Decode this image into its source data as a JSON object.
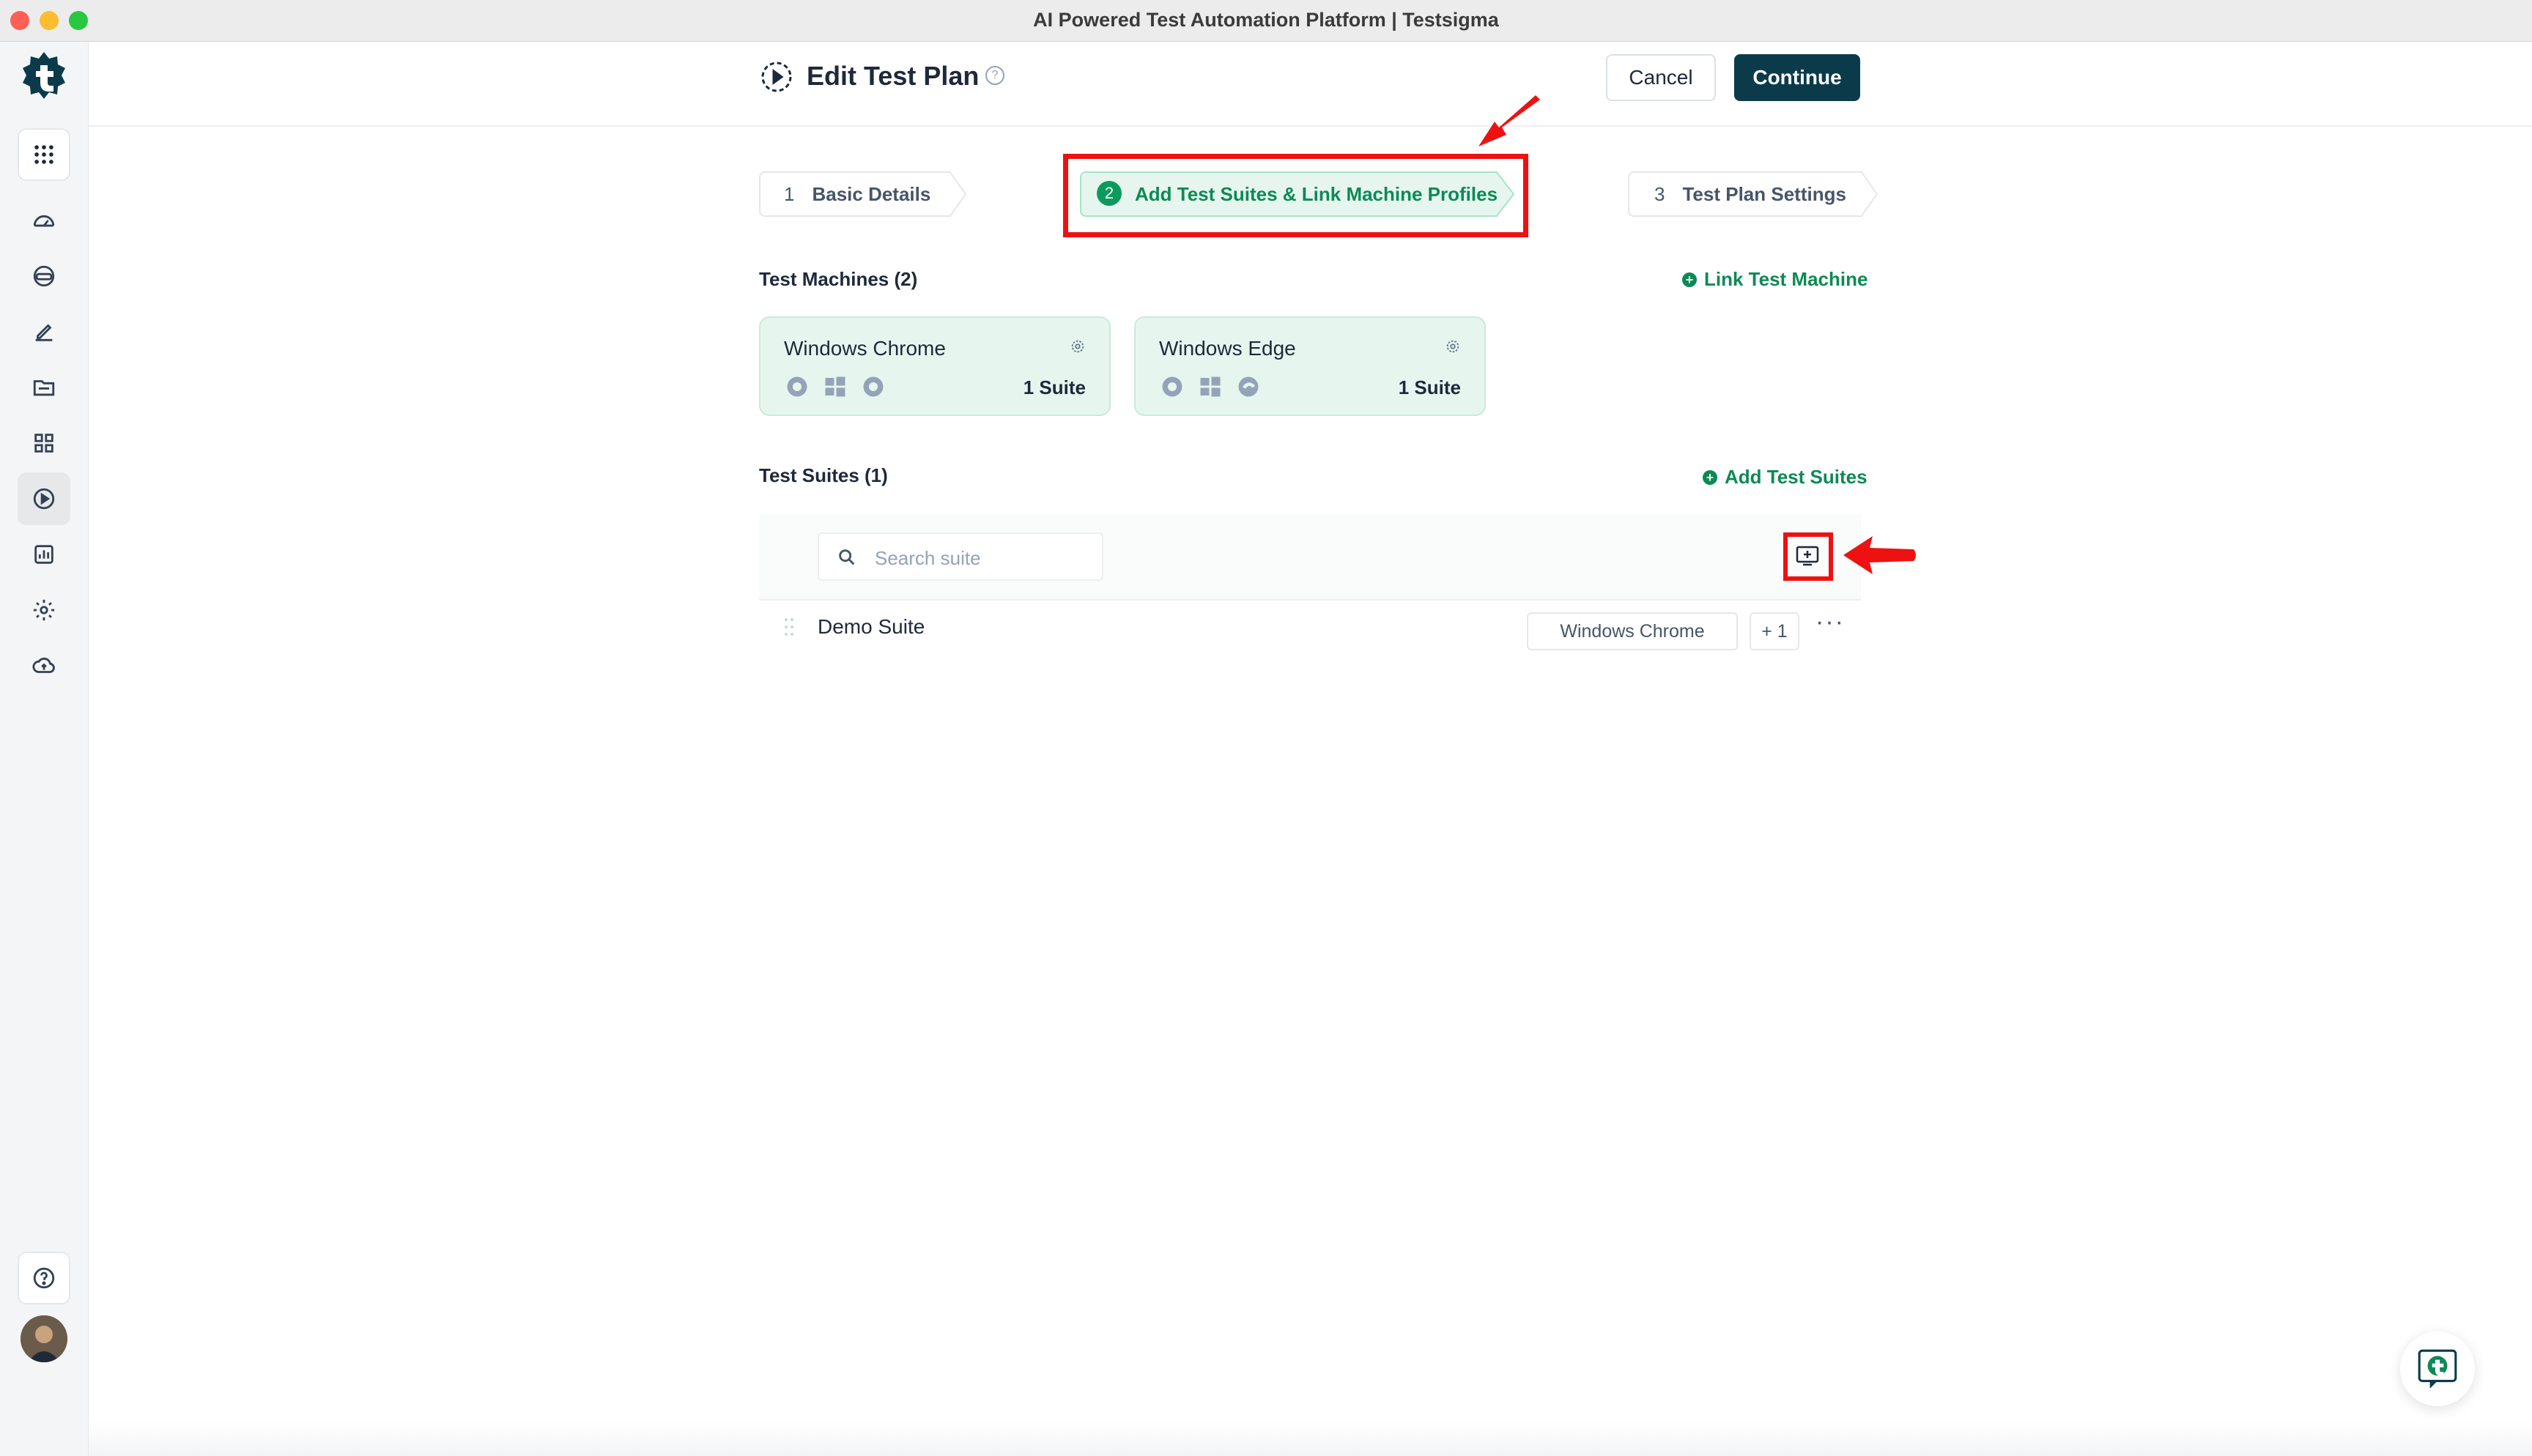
{
  "window": {
    "title": "AI Powered Test Automation Platform | Testsigma"
  },
  "sidebar": {
    "items": [
      {
        "name": "apps-grid-icon"
      },
      {
        "name": "dashboard-icon"
      },
      {
        "name": "ai-agent-icon"
      },
      {
        "name": "edit-icon"
      },
      {
        "name": "folder-icon"
      },
      {
        "name": "modules-icon"
      },
      {
        "name": "run-icon"
      },
      {
        "name": "reports-icon"
      },
      {
        "name": "settings-icon"
      },
      {
        "name": "cloud-icon"
      },
      {
        "name": "help-icon"
      }
    ]
  },
  "header": {
    "title": "Edit Test Plan",
    "help_glyph": "?",
    "cancel_label": "Cancel",
    "continue_label": "Continue"
  },
  "steps": [
    {
      "num": "1",
      "label": "Basic Details"
    },
    {
      "num": "2",
      "label": "Add Test Suites & Link Machine Profiles",
      "active": true
    },
    {
      "num": "3",
      "label": "Test Plan Settings"
    }
  ],
  "machines": {
    "title": "Test Machines (2)",
    "link_label": "Link Test Machine",
    "items": [
      {
        "name": "Windows Chrome",
        "count": "1 Suite",
        "icons": [
          "gear-icon",
          "windows-icon",
          "chrome-icon"
        ]
      },
      {
        "name": "Windows Edge",
        "count": "1 Suite",
        "icons": [
          "gear-icon",
          "windows-icon",
          "edge-icon"
        ]
      }
    ]
  },
  "suites": {
    "title": "Test Suites (1)",
    "add_label": "Add Test Suites",
    "search_placeholder": "Search suite",
    "rows": [
      {
        "name": "Demo Suite",
        "machine": "Windows Chrome",
        "extra": "+ 1",
        "more": "···"
      }
    ]
  },
  "colors": {
    "accent": "#0c8a55",
    "primary": "#0b3b4a",
    "highlight": "#ee1111"
  }
}
